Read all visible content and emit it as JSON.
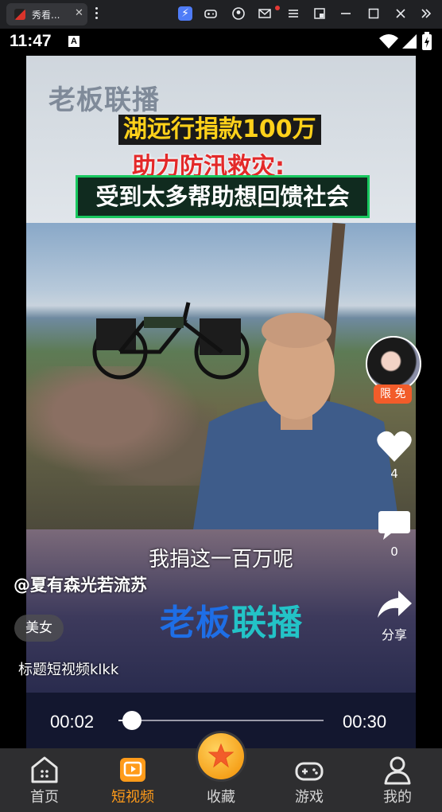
{
  "browser": {
    "tab_title": "秀看...",
    "tab_close": "✕",
    "icons": [
      "extension-active-icon",
      "gamepad-icon",
      "account-icon",
      "mail-icon",
      "menu-icon",
      "pip-icon",
      "minimize-icon",
      "maximize-icon",
      "close-icon",
      "collapse-icon"
    ]
  },
  "status_bar": {
    "time": "11:47",
    "indicator": "A"
  },
  "video": {
    "watermark_top": "老板联播",
    "headline_line1": "湖远行捐款100万",
    "headline_line2": "助力防汛救灾:",
    "headline_line3": "受到太多帮助想回馈社会",
    "subtitle": "我捐这一百万呢",
    "logo_part1": "老板",
    "logo_part2": "联播"
  },
  "overlay": {
    "username": "@夏有森光若流苏",
    "tag": "美女",
    "description": "标题短视频klkk"
  },
  "side_actions": {
    "badge_free": "限 免",
    "like_count": "4",
    "comment_count": "0",
    "share_label": "分享"
  },
  "player": {
    "current_time": "00:02",
    "total_time": "00:30",
    "progress_fraction": 0.067
  },
  "nav": {
    "items": [
      {
        "label": "首页",
        "icon": "home-icon"
      },
      {
        "label": "短视频",
        "icon": "short-video-icon"
      },
      {
        "label": "收藏",
        "icon": "star-icon"
      },
      {
        "label": "游戏",
        "icon": "gamepad-icon"
      },
      {
        "label": "我的",
        "icon": "profile-icon"
      }
    ],
    "active_index": 1
  },
  "colors": {
    "accent": "#ff9b1a",
    "nav_bg": "#2e2e30",
    "badge": "#f25c2a"
  }
}
